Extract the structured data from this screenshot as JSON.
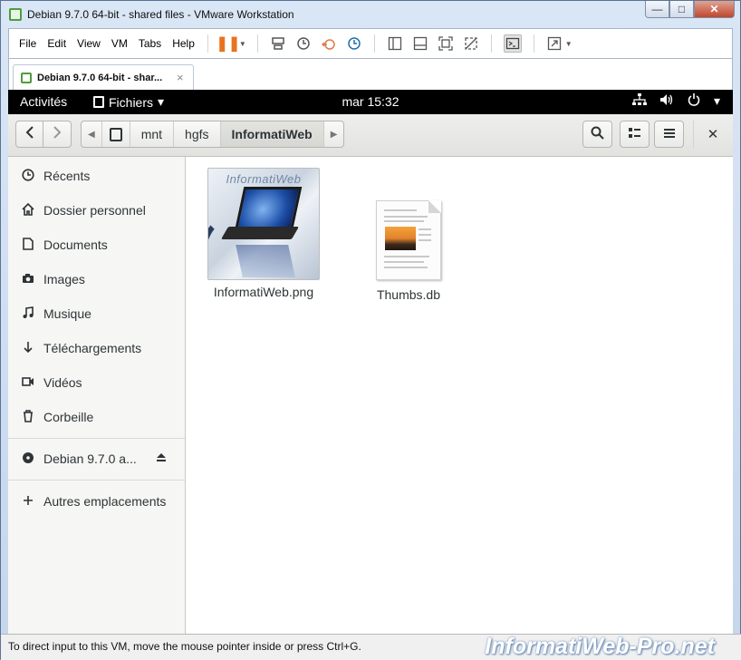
{
  "window": {
    "title": "Debian 9.7.0 64-bit - shared files - VMware Workstation",
    "minimize": "—",
    "maximize": "□",
    "close": "✕"
  },
  "menu": {
    "items": [
      "File",
      "Edit",
      "View",
      "VM",
      "Tabs",
      "Help"
    ]
  },
  "tab": {
    "label": "Debian 9.7.0 64-bit - shar...",
    "close": "×"
  },
  "gnome": {
    "activities": "Activités",
    "app_menu": "Fichiers",
    "app_menu_caret": "▾",
    "clock": "mar 15:32",
    "tray_caret": "▾"
  },
  "nautilus": {
    "path": [
      "mnt",
      "hgfs",
      "InformatiWeb"
    ],
    "path_left_arrow": "◀",
    "path_right_arrow": "▶",
    "close": "✕"
  },
  "sidebar": {
    "items": [
      {
        "label": "Récents",
        "icon": "clock-icon"
      },
      {
        "label": "Dossier personnel",
        "icon": "home-icon"
      },
      {
        "label": "Documents",
        "icon": "document-icon"
      },
      {
        "label": "Images",
        "icon": "camera-icon"
      },
      {
        "label": "Musique",
        "icon": "music-icon"
      },
      {
        "label": "Téléchargements",
        "icon": "download-icon"
      },
      {
        "label": "Vidéos",
        "icon": "video-icon"
      },
      {
        "label": "Corbeille",
        "icon": "trash-icon"
      }
    ],
    "device": {
      "label": "Debian 9.7.0 a...",
      "icon": "disc-icon"
    },
    "other": {
      "label": "Autres emplacements",
      "icon": "plus-icon"
    }
  },
  "files": [
    {
      "name": "InformatiWeb.png",
      "thumb_title": "InformatiWeb"
    },
    {
      "name": "Thumbs.db"
    }
  ],
  "status": {
    "text": "To direct input to this VM, move the mouse pointer inside or press Ctrl+G.",
    "watermark": "InformatiWeb-Pro.net"
  }
}
